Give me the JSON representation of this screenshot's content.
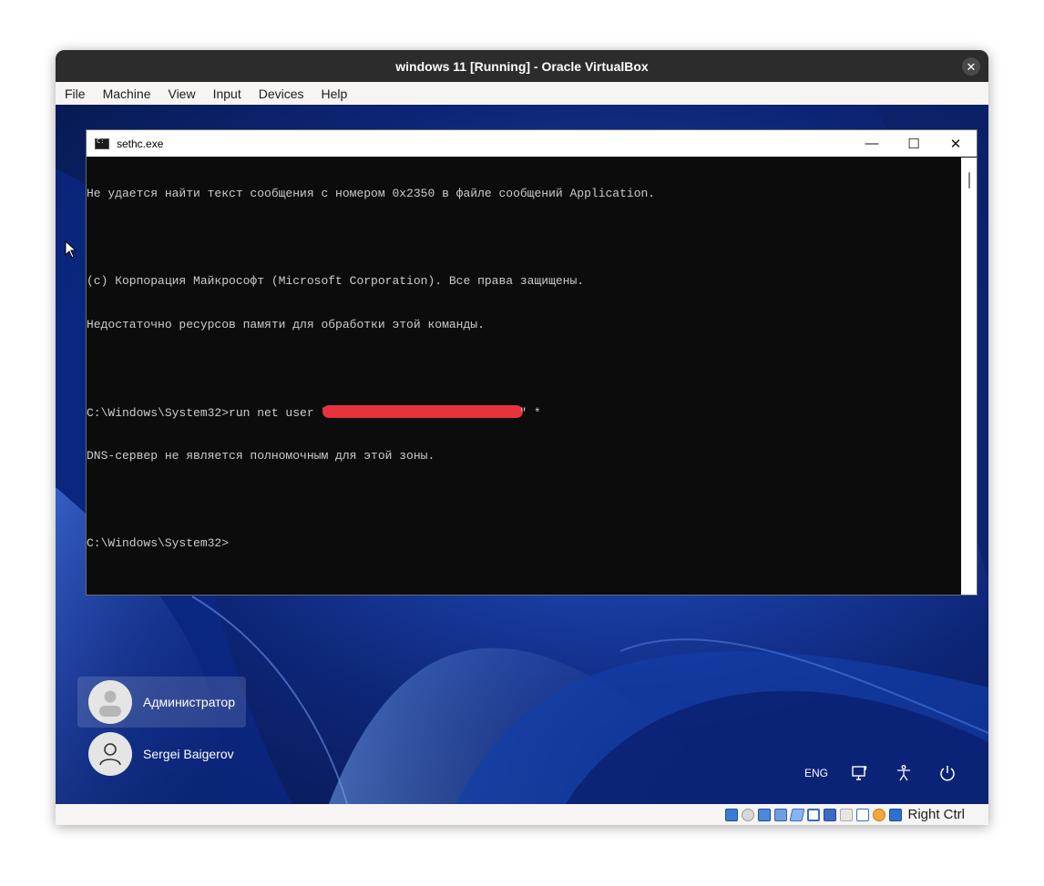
{
  "vbox": {
    "title": "windows 11 [Running] - Oracle VirtualBox",
    "menu": [
      "File",
      "Machine",
      "View",
      "Input",
      "Devices",
      "Help"
    ],
    "host_key": "Right Ctrl",
    "status_icons": [
      "hard-disk-icon",
      "optical-disk-icon",
      "audio-icon",
      "network-icon",
      "usb-icon",
      "shared-folders-icon",
      "display-icon",
      "recording-icon",
      "virtualization-icon",
      "mouse-integration-icon",
      "keyboard-capture-icon"
    ]
  },
  "cmd": {
    "title": "sethc.exe",
    "lines": [
      "Не удается найти текст сообщения с номером 0x2350 в файле сообщений Application.",
      "",
      "(c) Корпорация Майкрософт (Microsoft Corporation). Все права защищены.",
      "Недостаточно ресурсов памяти для обработки этой команды.",
      "",
      "",
      "DNS-сервер не является полномочным для этой зоны.",
      "",
      "C:\\Windows\\System32>"
    ],
    "redacted_line_prefix": "C:\\Windows\\System32>run net user \"",
    "redacted_line_suffix": "\" *"
  },
  "lockscreen": {
    "users": [
      {
        "name": "Администратор",
        "selected": true
      },
      {
        "name": "Sergei Baigerov",
        "selected": false
      }
    ],
    "language": "ENG"
  },
  "colors": {
    "redaction": "#e8323c",
    "console_bg": "#0c0c0c",
    "console_text": "#cccccc"
  }
}
